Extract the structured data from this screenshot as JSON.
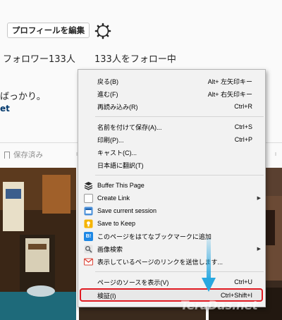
{
  "profile": {
    "edit_button": "プロフィールを編集",
    "followers": "フォロワー133人",
    "following": "133人をフォロー中",
    "bio": "ばっかり。",
    "bio_link": "et",
    "saved_tab": "保存済み"
  },
  "context_menu": {
    "items": [
      {
        "label": "戻る(B)",
        "shortcut": "Alt+ 左矢印キー"
      },
      {
        "label": "進む(F)",
        "shortcut": "Alt+ 右矢印キー"
      },
      {
        "label": "再読み込み(R)",
        "shortcut": "Ctrl+R"
      },
      {
        "label": "名前を付けて保存(A)...",
        "shortcut": "Ctrl+S"
      },
      {
        "label": "印刷(P)...",
        "shortcut": "Ctrl+P"
      },
      {
        "label": "キャスト(C)...",
        "shortcut": ""
      },
      {
        "label": "日本語に翻訳(T)",
        "shortcut": ""
      },
      {
        "label": "Buffer This Page",
        "shortcut": "",
        "icon": "buffer-icon",
        "color": "#2b2b2b"
      },
      {
        "label": "Create Link",
        "shortcut": "",
        "icon": "create-link-icon",
        "color": "#ffffff",
        "submenu": true
      },
      {
        "label": "Save current session",
        "shortcut": "",
        "icon": "session-icon",
        "color": "#4a90d9"
      },
      {
        "label": "Save to Keep",
        "shortcut": "",
        "icon": "keep-icon",
        "color": "#f5b400"
      },
      {
        "label": "このページをはてなブックマークに追加",
        "shortcut": "",
        "icon": "hatena-icon",
        "color": "#1e88e5",
        "icon_text": "B!"
      },
      {
        "label": "画像検索",
        "shortcut": "",
        "icon": "image-search-icon",
        "color": "#5f6368",
        "submenu": true
      },
      {
        "label": "表示しているページのリンクを送信します...",
        "shortcut": "",
        "icon": "mail-icon",
        "color": "#db4437"
      },
      {
        "label": "ページのソースを表示(V)",
        "shortcut": "Ctrl+U"
      },
      {
        "label": "検証(I)",
        "shortcut": "Ctrl+Shift+I"
      }
    ],
    "submenu_arrow": "▶",
    "highlight_color": "#e11b22"
  },
  "annotation": {
    "arrow_color": "#29a8e0"
  },
  "watermark": "TeraDas.net"
}
